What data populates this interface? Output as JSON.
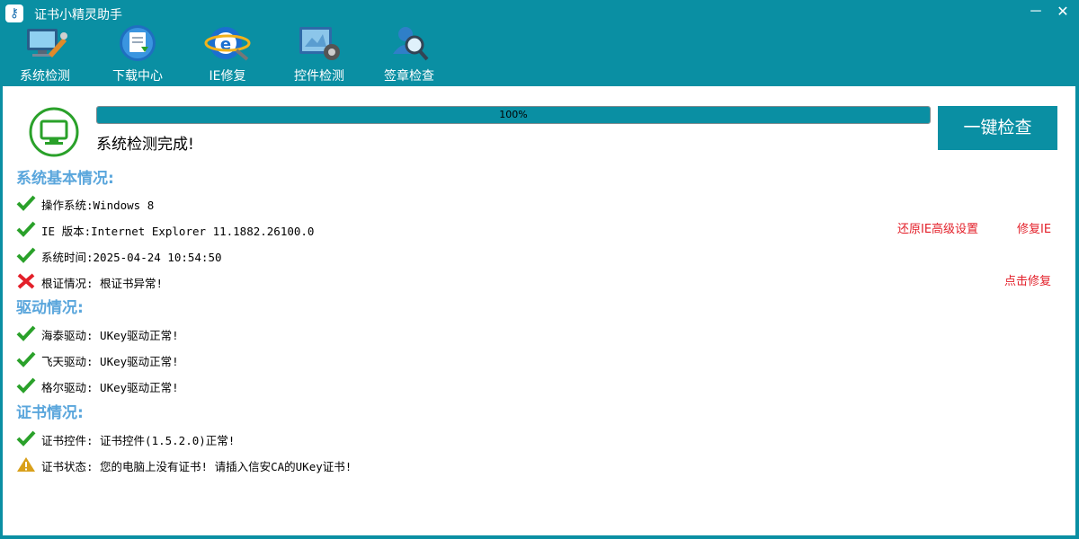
{
  "window": {
    "title": "证书小精灵助手",
    "minimize": "－",
    "close": "✕"
  },
  "toolbar": [
    {
      "label": "系统检测",
      "icon": "system-check-icon"
    },
    {
      "label": "下载中心",
      "icon": "download-center-icon"
    },
    {
      "label": "IE修复",
      "icon": "ie-repair-icon"
    },
    {
      "label": "控件检测",
      "icon": "control-check-icon"
    },
    {
      "label": "签章检查",
      "icon": "seal-check-icon"
    }
  ],
  "status": {
    "progress_pct": 100,
    "progress_text": "100%",
    "message": "系统检测完成!",
    "one_key_button": "一键检查"
  },
  "sections": {
    "basic": "系统基本情况:",
    "driver": "驱动情况:",
    "cert": "证书情况:"
  },
  "basic_rows": [
    {
      "text": "操作系统:Windows 8",
      "status": "ok"
    },
    {
      "text": "IE 版本:Internet Explorer 11.1882.26100.0",
      "status": "ok"
    },
    {
      "text": "系统时间:2025-04-24 10:54:50",
      "status": "ok"
    },
    {
      "text": "根证情况: 根证书异常!",
      "status": "error"
    }
  ],
  "driver_rows": [
    {
      "text": "海泰驱动: UKey驱动正常!",
      "status": "ok"
    },
    {
      "text": "飞天驱动: UKey驱动正常!",
      "status": "ok"
    },
    {
      "text": "格尔驱动: UKey驱动正常!",
      "status": "ok"
    }
  ],
  "cert_rows": [
    {
      "text": "证书控件: 证书控件(1.5.2.0)正常!",
      "status": "ok"
    },
    {
      "text": "证书状态: 您的电脑上没有证书! 请插入信安CA的UKey证书!",
      "status": "warning"
    }
  ],
  "links": {
    "restore_ie": "还原IE高级设置",
    "repair_ie": "修复IE",
    "click_repair": "点击修复"
  },
  "colors": {
    "accent": "#0a8fa3",
    "section": "#5aa6dc",
    "ok": "#2aa12a",
    "error": "#e3202a",
    "warning": "#d9a01a",
    "link": "#e3202a"
  }
}
